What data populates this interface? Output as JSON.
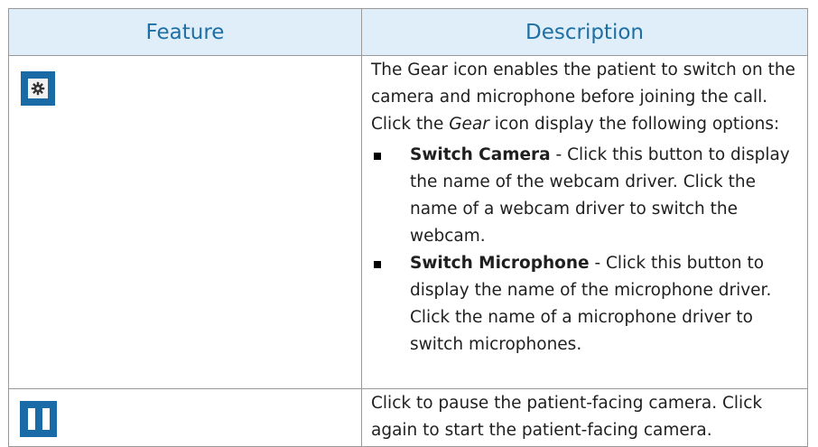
{
  "table": {
    "headers": [
      "Feature",
      "Description"
    ],
    "rows": [
      {
        "icon": "gear-icon",
        "intro_1": "The Gear icon enables the patient to switch on the camera and microphone before joining the call. Click the ",
        "intro_em": "Gear",
        "intro_2": " icon display the following options:",
        "bullets": [
          {
            "term": "Switch Camera",
            "text": " - Click this button to display the name of the webcam driver. Click the name of a webcam driver to switch the webcam."
          },
          {
            "term": "Switch Microphone",
            "text": " - Click this button to display the name of the microphone driver. Click the name of a microphone driver to switch microphones."
          }
        ]
      },
      {
        "icon": "pause-icon",
        "text": "Click to pause the patient-facing camera. Click again to start the patient-facing camera."
      }
    ]
  },
  "colors": {
    "header_bg": "#dfeef8",
    "header_text": "#1e6fa3",
    "icon_blue": "#1a6aa6"
  }
}
